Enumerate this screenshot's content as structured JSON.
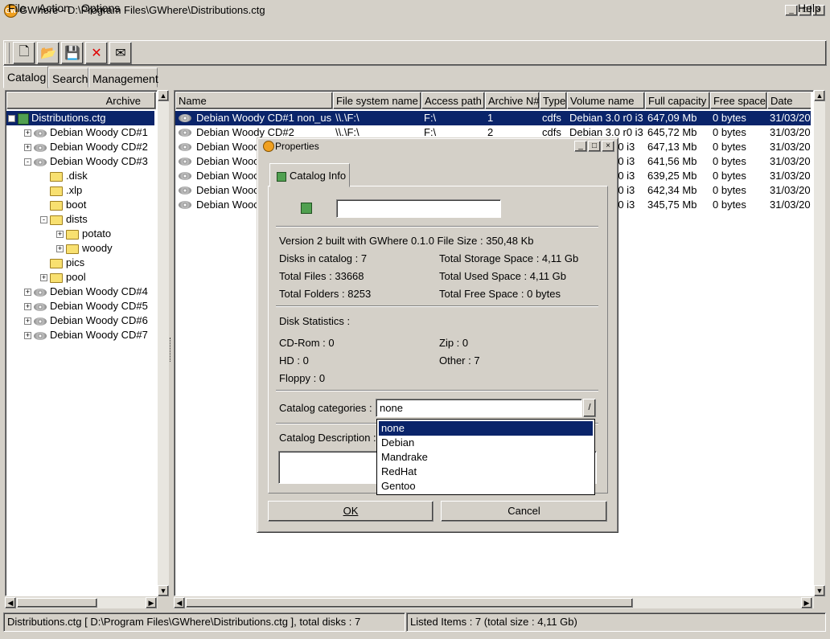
{
  "window": {
    "title": "GWhere - D:\\Program Files\\GWhere\\Distributions.ctg",
    "icon_label": "GW",
    "minimize_glyph": "_",
    "maximize_glyph": "□",
    "close_glyph": "×"
  },
  "menubar": {
    "file": "File",
    "action": "Action",
    "options": "Options",
    "help": "Help"
  },
  "toolbar": {
    "buttons": [
      {
        "icon": "new-icon",
        "glyph": "🗋"
      },
      {
        "icon": "open-icon",
        "glyph": "📂"
      },
      {
        "icon": "save-icon",
        "glyph": "💾"
      },
      {
        "icon": "close-icon",
        "glyph": "✕"
      },
      {
        "icon": "mail-icon",
        "glyph": "✉"
      }
    ]
  },
  "tabs": {
    "catalog": "Catalog",
    "search": "Search",
    "management": "Management"
  },
  "tree": {
    "header": "Archive",
    "rows": [
      {
        "label": "Distributions.ctg",
        "kind": "root",
        "level": 0,
        "expander": "-"
      },
      {
        "label": "Debian Woody CD#1",
        "kind": "cd",
        "level": 1,
        "expander": "+"
      },
      {
        "label": "Debian Woody CD#2",
        "kind": "cd",
        "level": 1,
        "expander": "+"
      },
      {
        "label": "Debian Woody CD#3",
        "kind": "cd",
        "level": 1,
        "expander": "-"
      },
      {
        "label": ".disk",
        "kind": "folder",
        "level": 2,
        "expander": ""
      },
      {
        "label": ".xlp",
        "kind": "folder",
        "level": 2,
        "expander": ""
      },
      {
        "label": "boot",
        "kind": "folder",
        "level": 2,
        "expander": ""
      },
      {
        "label": "dists",
        "kind": "folder",
        "level": 2,
        "expander": "-"
      },
      {
        "label": "potato",
        "kind": "folder",
        "level": 3,
        "expander": "+"
      },
      {
        "label": "woody",
        "kind": "folder",
        "level": 3,
        "expander": "+"
      },
      {
        "label": "pics",
        "kind": "folder",
        "level": 2,
        "expander": ""
      },
      {
        "label": "pool",
        "kind": "folder",
        "level": 2,
        "expander": "+"
      },
      {
        "label": "Debian Woody CD#4",
        "kind": "cd",
        "level": 1,
        "expander": "+"
      },
      {
        "label": "Debian Woody CD#5",
        "kind": "cd",
        "level": 1,
        "expander": "+"
      },
      {
        "label": "Debian Woody CD#6",
        "kind": "cd",
        "level": 1,
        "expander": "+"
      },
      {
        "label": "Debian Woody CD#7",
        "kind": "cd",
        "level": 1,
        "expander": "+"
      }
    ]
  },
  "list": {
    "columns": [
      "Name",
      "File system name",
      "Access path",
      "Archive N#",
      "Type",
      "Volume name",
      "Full capacity",
      "Free space",
      "Date"
    ],
    "rows": [
      [
        "Debian Woody CD#1 non_us",
        "\\\\.\\F:\\",
        "F:\\",
        "1",
        "cdfs",
        "Debian 3.0 r0 i3",
        "647,09 Mb",
        "0 bytes",
        "31/03/20"
      ],
      [
        "Debian Woody CD#2",
        "\\\\.\\F:\\",
        "F:\\",
        "2",
        "cdfs",
        "Debian 3.0 r0 i3",
        "645,72 Mb",
        "0 bytes",
        "31/03/20"
      ],
      [
        "Debian Wooc",
        "",
        "",
        "",
        "",
        "r0 i3",
        "647,13 Mb",
        "0 bytes",
        "31/03/20"
      ],
      [
        "Debian Wooc",
        "",
        "",
        "",
        "",
        "r0 i3",
        "641,56 Mb",
        "0 bytes",
        "31/03/20"
      ],
      [
        "Debian Wooc",
        "",
        "",
        "",
        "",
        "r0 i3",
        "639,25 Mb",
        "0 bytes",
        "31/03/20"
      ],
      [
        "Debian Wooc",
        "",
        "",
        "",
        "",
        "r0 i3",
        "642,34 Mb",
        "0 bytes",
        "31/03/20"
      ],
      [
        "Debian Wooc",
        "",
        "",
        "",
        "",
        "r0 i3",
        "345,75 Mb",
        "0 bytes",
        "31/03/20"
      ]
    ]
  },
  "statusbar": {
    "left": "Distributions.ctg [ D:\\Program Files\\GWhere\\Distributions.ctg ], total disks : 7",
    "right": "Listed Items : 7 (total size : 4,11 Gb)"
  },
  "dialog": {
    "title": "Properties",
    "tab_label": "Catalog Info",
    "catalog_name_value": "",
    "version_line": "Version 2 built with GWhere 0.1.0 File Size : 350,48 Kb",
    "stats_left": [
      "Disks in catalog : 7",
      "Total Files : 33668",
      "Total Folders : 8253"
    ],
    "stats_right": [
      "Total Storage Space : 4,11 Gb",
      "Total Used Space : 4,11 Gb",
      "Total Free Space : 0 bytes"
    ],
    "disk_stats_heading": "Disk Statistics :",
    "disk_left": [
      "CD-Rom : 0",
      "HD : 0",
      "Floppy : 0"
    ],
    "disk_right": [
      "Zip : 0",
      "Other : 7"
    ],
    "categories_label": "Catalog categories :",
    "categories_value": "none",
    "categories_arrow": "/",
    "category_options": [
      "none",
      "Debian",
      "Mandrake",
      "RedHat",
      "Gentoo"
    ],
    "description_label": "Catalog Description :",
    "ok_label": "OK",
    "cancel_label": "Cancel"
  },
  "colors": {
    "selection": "#0a246a",
    "face": "#d4d0c8"
  }
}
